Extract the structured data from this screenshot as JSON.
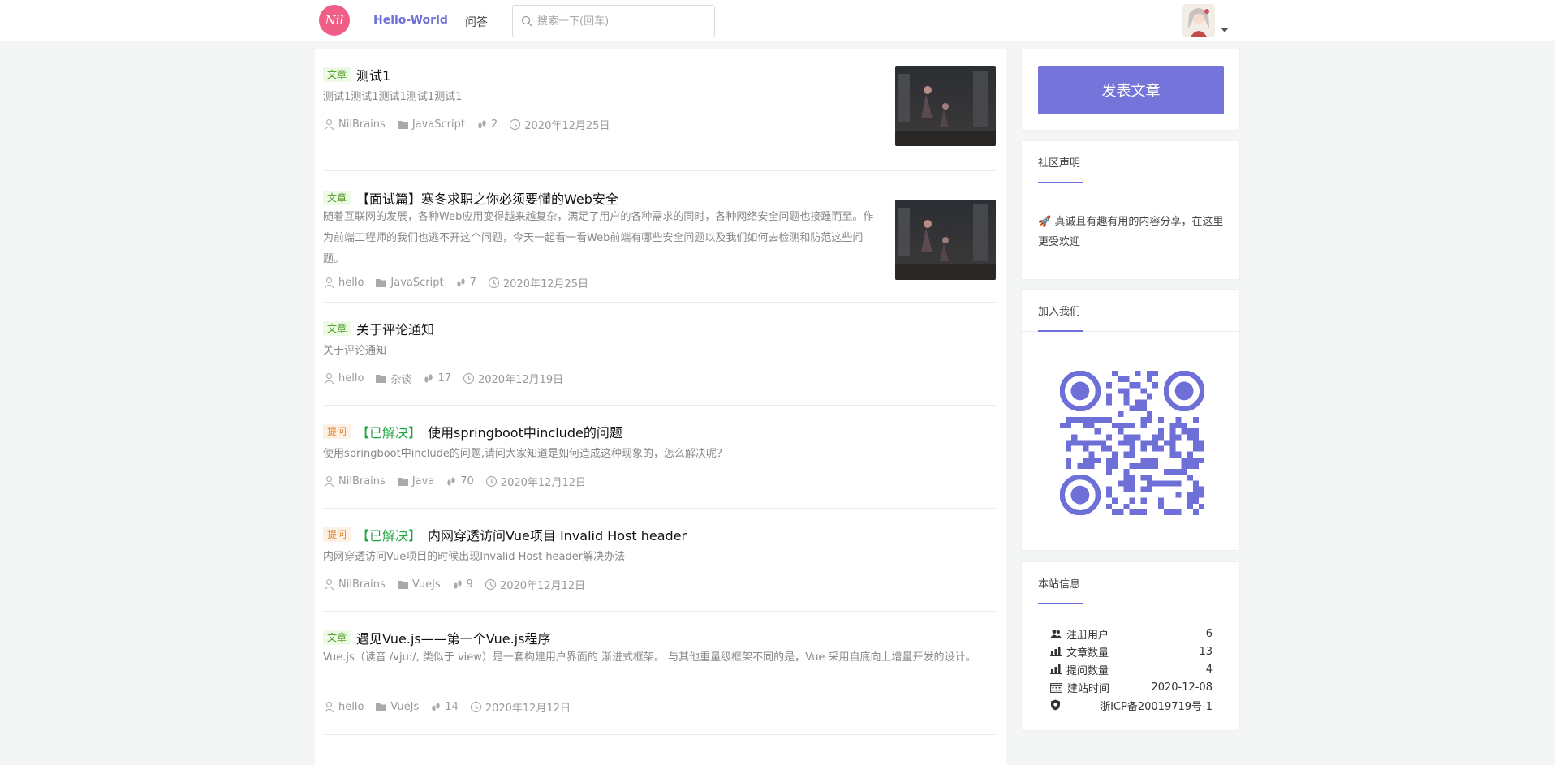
{
  "header": {
    "logo_text": "Nil",
    "nav": {
      "home": "Hello-World",
      "qa": "问答"
    },
    "search": {
      "placeholder": "搜索一下(回车)"
    }
  },
  "articles": [
    {
      "tag": "文章",
      "solved": "",
      "title": "测试1",
      "summary": "测试1测试1测试1测试1测试1",
      "author": "NilBrains",
      "category": "JavaScript",
      "views": "2",
      "date": "2020年12月25日",
      "thumbnail": true
    },
    {
      "tag": "文章",
      "solved": "",
      "title": "【面试篇】寒冬求职之你必须要懂的Web安全",
      "summary": "随着互联网的发展，各种Web应用变得越来越复杂，满足了用户的各种需求的同时，各种网络安全问题也接踵而至。作为前端工程师的我们也逃不开这个问题，今天一起看一看Web前端有哪些安全问题以及我们如何去检测和防范这些问题。",
      "author": "hello",
      "category": "JavaScript",
      "views": "7",
      "date": "2020年12月25日",
      "thumbnail": true
    },
    {
      "tag": "文章",
      "solved": "",
      "title": "关于评论通知",
      "summary": "关于评论通知",
      "author": "hello",
      "category": "杂谈",
      "views": "17",
      "date": "2020年12月19日",
      "thumbnail": false
    },
    {
      "tag": "提问",
      "solved": "【已解决】",
      "title": "使用springboot中include的问题",
      "summary": "使用springboot中include的问题,请问大家知道是如何造成这种现象的，怎么解决呢？",
      "author": "NilBrains",
      "category": "Java",
      "views": "70",
      "date": "2020年12月12日",
      "thumbnail": false
    },
    {
      "tag": "提问",
      "solved": "【已解决】",
      "title": "内网穿透访问Vue项目 Invalid Host header",
      "summary": "内网穿透访问Vue项目的时候出现Invalid Host header解决办法",
      "author": "NilBrains",
      "category": "VueJs",
      "views": "9",
      "date": "2020年12月12日",
      "thumbnail": false
    },
    {
      "tag": "文章",
      "solved": "",
      "title": "遇见Vue.js——第一个Vue.js程序",
      "summary": "Vue.js（读音 /vjuː/, 类似于 view）是一套构建用户界面的 渐进式框架。 与其他重量级框架不同的是，Vue 采用自底向上增量开发的设计。",
      "author": "hello",
      "category": "VueJs",
      "views": "14",
      "date": "2020年12月12日",
      "thumbnail": false
    }
  ],
  "sidebar": {
    "publish_label": "发表文章",
    "notice": {
      "title": "社区声明",
      "text": "🚀 真诚且有趣有用的内容分享，在这里更受欢迎"
    },
    "join": {
      "title": "加入我们"
    },
    "stats": {
      "title": "本站信息",
      "rows": [
        {
          "label": "注册用户",
          "value": "6",
          "icon": "users-icon"
        },
        {
          "label": "文章数量",
          "value": "13",
          "icon": "bar-chart-icon"
        },
        {
          "label": "提问数量",
          "value": "4",
          "icon": "bar-chart-icon"
        },
        {
          "label": "建站时间",
          "value": "2020-12-08",
          "icon": "calendar-icon"
        },
        {
          "label": "",
          "value": "浙ICP备20019719号-1",
          "icon": "shield-icon"
        }
      ]
    }
  },
  "colors": {
    "accent": "#6f6fd8",
    "button": "#7474db",
    "logo": "#f05d86",
    "article_tag": "#4d9b24",
    "question_tag": "#e08a37",
    "solved": "#21a543"
  }
}
